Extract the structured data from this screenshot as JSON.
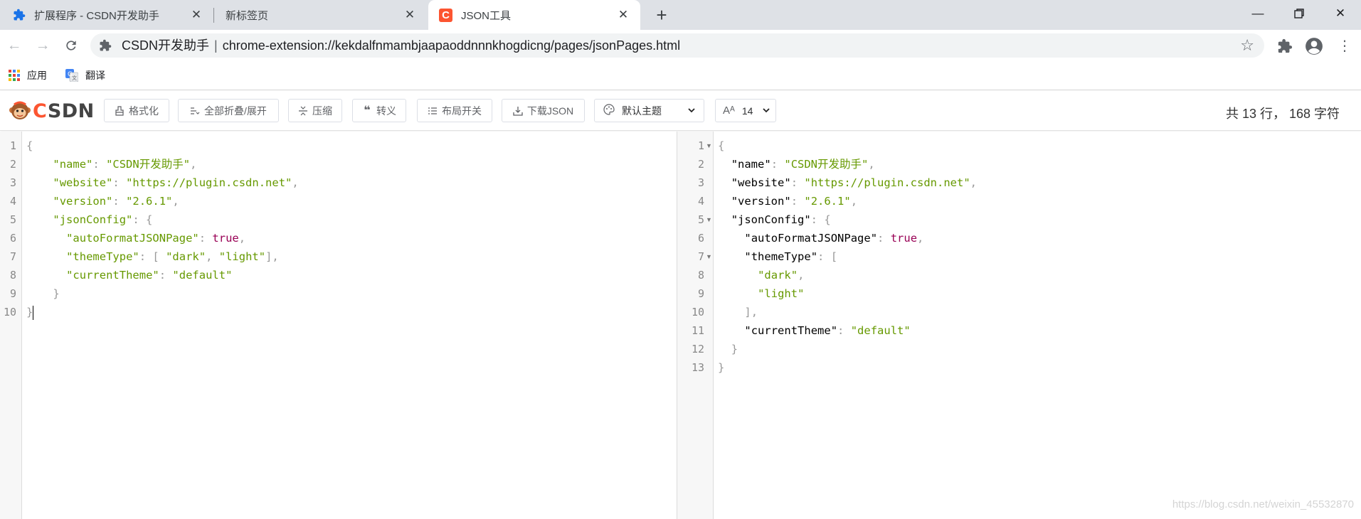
{
  "browser": {
    "tabs": [
      {
        "title": "扩展程序 - CSDN开发助手",
        "active": false
      },
      {
        "title": "新标签页",
        "active": false
      },
      {
        "title": "JSON工具",
        "active": true
      }
    ],
    "omnibox": {
      "site_name": "CSDN开发助手",
      "separator": "|",
      "url": "chrome-extension://kekdalfnmambjaapaoddnnnkhogdicng/pages/jsonPages.html"
    },
    "bookmarks": [
      {
        "label": "应用",
        "icon": "apps-grid-icon"
      },
      {
        "label": "翻译",
        "icon": "google-translate-icon"
      }
    ]
  },
  "app": {
    "logo_text": "CSDN",
    "toolbar": {
      "format": "格式化",
      "fold_all": "全部折叠/展开",
      "compress": "压缩",
      "escape": "转义",
      "layout_toggle": "布局开关",
      "download": "下载JSON",
      "theme_selected": "默认主题",
      "font_size": "14"
    },
    "stats": "共 13 行， 168 字符",
    "accent_color": "#fc5531"
  },
  "left_editor": {
    "line_numbers": [
      "1",
      "2",
      "3",
      "4",
      "5",
      "6",
      "7",
      "8",
      "9",
      "10"
    ],
    "lines": [
      {
        "indent": 0,
        "tokens": [
          {
            "t": "p",
            "v": "{"
          }
        ]
      },
      {
        "indent": 4,
        "tokens": [
          {
            "t": "s",
            "v": "\"name\""
          },
          {
            "t": "p",
            "v": ": "
          },
          {
            "t": "s",
            "v": "\"CSDN开发助手\""
          },
          {
            "t": "p",
            "v": ","
          }
        ]
      },
      {
        "indent": 4,
        "tokens": [
          {
            "t": "s",
            "v": "\"website\""
          },
          {
            "t": "p",
            "v": ": "
          },
          {
            "t": "s",
            "v": "\"https://plugin.csdn.net\""
          },
          {
            "t": "p",
            "v": ","
          }
        ]
      },
      {
        "indent": 4,
        "tokens": [
          {
            "t": "s",
            "v": "\"version\""
          },
          {
            "t": "p",
            "v": ": "
          },
          {
            "t": "s",
            "v": "\"2.6.1\""
          },
          {
            "t": "p",
            "v": ","
          }
        ]
      },
      {
        "indent": 4,
        "tokens": [
          {
            "t": "s",
            "v": "\"jsonConfig\""
          },
          {
            "t": "p",
            "v": ": {"
          }
        ]
      },
      {
        "indent": 6,
        "tokens": [
          {
            "t": "s",
            "v": "\"autoFormatJSONPage\""
          },
          {
            "t": "p",
            "v": ": "
          },
          {
            "t": "b",
            "v": "true"
          },
          {
            "t": "p",
            "v": ","
          }
        ]
      },
      {
        "indent": 6,
        "tokens": [
          {
            "t": "s",
            "v": "\"themeType\""
          },
          {
            "t": "p",
            "v": ": [ "
          },
          {
            "t": "s",
            "v": "\"dark\""
          },
          {
            "t": "p",
            "v": ", "
          },
          {
            "t": "s",
            "v": "\"light\""
          },
          {
            "t": "p",
            "v": "],"
          }
        ]
      },
      {
        "indent": 6,
        "tokens": [
          {
            "t": "s",
            "v": "\"currentTheme\""
          },
          {
            "t": "p",
            "v": ": "
          },
          {
            "t": "s",
            "v": "\"default\""
          }
        ]
      },
      {
        "indent": 4,
        "tokens": [
          {
            "t": "p",
            "v": "}"
          }
        ]
      },
      {
        "indent": 0,
        "tokens": [
          {
            "t": "p",
            "v": "}"
          }
        ],
        "cursor": true
      }
    ]
  },
  "right_editor": {
    "line_numbers": [
      "1",
      "2",
      "3",
      "4",
      "5",
      "6",
      "7",
      "8",
      "9",
      "10",
      "11",
      "12",
      "13"
    ],
    "fold_lines": [
      1,
      5,
      7
    ],
    "lines": [
      {
        "indent": 0,
        "tokens": [
          {
            "t": "p",
            "v": "{"
          }
        ]
      },
      {
        "indent": 2,
        "tokens": [
          {
            "t": "kk",
            "v": "\"name\""
          },
          {
            "t": "p",
            "v": ": "
          },
          {
            "t": "s",
            "v": "\"CSDN开发助手\""
          },
          {
            "t": "p",
            "v": ","
          }
        ]
      },
      {
        "indent": 2,
        "tokens": [
          {
            "t": "kk",
            "v": "\"website\""
          },
          {
            "t": "p",
            "v": ": "
          },
          {
            "t": "s",
            "v": "\"https://plugin.csdn.net\""
          },
          {
            "t": "p",
            "v": ","
          }
        ]
      },
      {
        "indent": 2,
        "tokens": [
          {
            "t": "kk",
            "v": "\"version\""
          },
          {
            "t": "p",
            "v": ": "
          },
          {
            "t": "s",
            "v": "\"2.6.1\""
          },
          {
            "t": "p",
            "v": ","
          }
        ]
      },
      {
        "indent": 2,
        "tokens": [
          {
            "t": "kk",
            "v": "\"jsonConfig\""
          },
          {
            "t": "p",
            "v": ": {"
          }
        ]
      },
      {
        "indent": 4,
        "tokens": [
          {
            "t": "kk",
            "v": "\"autoFormatJSONPage\""
          },
          {
            "t": "p",
            "v": ": "
          },
          {
            "t": "b",
            "v": "true"
          },
          {
            "t": "p",
            "v": ","
          }
        ]
      },
      {
        "indent": 4,
        "tokens": [
          {
            "t": "kk",
            "v": "\"themeType\""
          },
          {
            "t": "p",
            "v": ": ["
          }
        ]
      },
      {
        "indent": 6,
        "tokens": [
          {
            "t": "s",
            "v": "\"dark\""
          },
          {
            "t": "p",
            "v": ","
          }
        ]
      },
      {
        "indent": 6,
        "tokens": [
          {
            "t": "s",
            "v": "\"light\""
          }
        ]
      },
      {
        "indent": 4,
        "tokens": [
          {
            "t": "p",
            "v": "],"
          }
        ]
      },
      {
        "indent": 4,
        "tokens": [
          {
            "t": "kk",
            "v": "\"currentTheme\""
          },
          {
            "t": "p",
            "v": ": "
          },
          {
            "t": "s",
            "v": "\"default\""
          }
        ]
      },
      {
        "indent": 2,
        "tokens": [
          {
            "t": "p",
            "v": "}"
          }
        ]
      },
      {
        "indent": 0,
        "tokens": [
          {
            "t": "p",
            "v": "}"
          }
        ]
      }
    ]
  },
  "watermark": "https://blog.csdn.net/weixin_45532870"
}
